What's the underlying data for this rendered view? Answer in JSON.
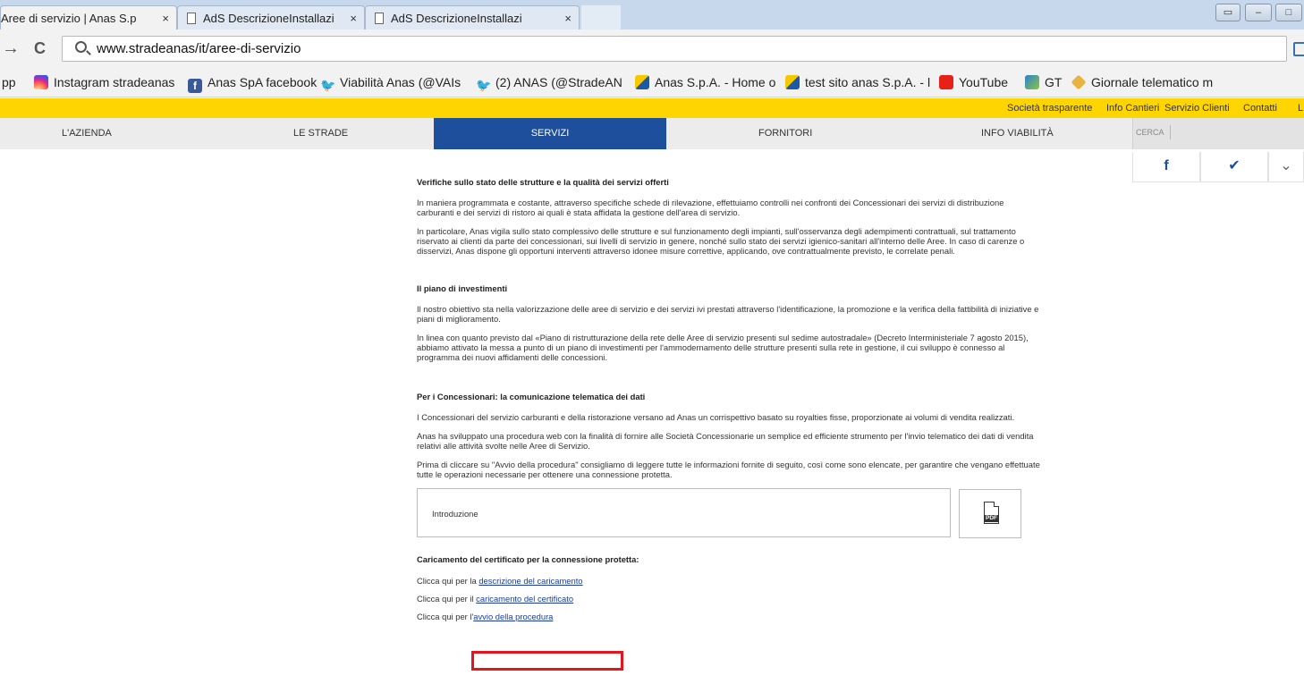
{
  "browser": {
    "tabs": [
      {
        "title": "Aree di servizio | Anas S.p",
        "close": "×"
      },
      {
        "title": "AdS DescrizioneInstallazi",
        "close": "×"
      },
      {
        "title": "AdS DescrizioneInstallazi",
        "close": "×"
      }
    ],
    "window_buttons": [
      "▭",
      "–",
      "□"
    ],
    "url": "www.stradeanas/it/aree-di-servizio",
    "nav": {
      "back": "→",
      "reload": "C"
    },
    "bookmarks_prefix": "pp",
    "bookmarks": [
      {
        "label": "Instagram stradeanas",
        "icon": "instagram-icon"
      },
      {
        "label": "Anas SpA facebook",
        "icon": "facebook-icon"
      },
      {
        "label": "Viabilità Anas (@VAIs",
        "icon": "twitter-icon"
      },
      {
        "label": "(2) ANAS (@StradeAN",
        "icon": "twitter-icon"
      },
      {
        "label": "Anas S.p.A. - Home o",
        "icon": "anas-icon"
      },
      {
        "label": "test sito anas S.p.A. - l",
        "icon": "anas-icon"
      },
      {
        "label": "YouTube",
        "icon": "youtube-icon"
      },
      {
        "label": "GT",
        "icon": "gt-icon"
      },
      {
        "label": "Giornale telematico m",
        "icon": "diamond-icon"
      }
    ]
  },
  "site": {
    "top_links": [
      "Società trasparente",
      "Info Cantieri",
      "Servizio Clienti",
      "Contatti",
      "L"
    ],
    "nav": [
      "L'AZIENDA",
      "LE STRADE",
      "SERVIZI",
      "FORNITORI",
      "INFO VIABILITÀ"
    ],
    "search_label": "CERCA",
    "social": [
      "f",
      "✔",
      "⌄"
    ]
  },
  "content": {
    "sec1_title": "Verifiche sullo stato delle strutture e la qualità dei servizi offerti",
    "sec1_p1": "In maniera programmata e costante, attraverso specifiche schede di rilevazione, effettuiamo controlli nei confronti dei Concessionari dei servizi di distribuzione carburanti e dei servizi di ristoro ai quali è stata affidata la gestione dell'area di servizio.",
    "sec1_p2": "In particolare, Anas vigila sullo stato complessivo delle strutture e sul funzionamento degli impianti, sull'osservanza degli adempimenti contrattuali, sul trattamento riservato ai clienti da parte dei concessionari, sui livelli di servizio in genere, nonché sullo stato dei servizi igienico-sanitari all'interno delle Aree. In caso di carenze o disservizi, Anas dispone gli opportuni interventi attraverso idonee misure correttive, applicando, ove contrattualmente previsto, le correlate penali.",
    "sec2_title": "Il piano di investimenti",
    "sec2_p1": "Il nostro obiettivo sta nella valorizzazione delle aree di servizio e dei servizi ivi prestati attraverso l'identificazione, la promozione e la verifica della fattibilità di iniziative e piani di miglioramento.",
    "sec2_p2": "In linea con quanto previsto dal «Piano di ristrutturazione della rete delle Aree di servizio presenti sul sedime autostradale» (Decreto Interministeriale 7 agosto 2015), abbiamo attivato la messa a punto di un piano di investimenti per l'ammodernamento delle strutture presenti sulla rete in gestione, il cui sviluppo è connesso al programma dei nuovi affidamenti delle concessioni.",
    "sec3_title": "Per i Concessionari: la comunicazione telematica dei dati",
    "sec3_p1": "I Concessionari del servizio carburanti e della ristorazione versano ad Anas un corrispettivo basato su royalties fisse, proporzionate ai volumi di vendita realizzati.",
    "sec3_p2": "Anas ha sviluppato una procedura web con la finalità di fornire alle Società Concessionarie un semplice ed efficiente strumento per l'invio telematico dei dati di vendita relativi alle attività svolte nelle Aree di Servizio.",
    "sec3_p3": "Prima di cliccare su \"Avvio della procedura\" consigliamo di leggere tutte le informazioni fornite di seguito, così come sono elencate, per garantire che vengano effettuate tutte le operazioni necessarie per ottenere una connessione protetta.",
    "intro_label": "Introduzione",
    "pdf_tag": "PDF",
    "cert_title": "Caricamento del certificato per la connessione protetta:",
    "links": [
      {
        "prefix": "Clicca qui per la ",
        "link": "descrizione del caricamento"
      },
      {
        "prefix": "Clicca qui per il ",
        "link": "caricamento del certificato"
      },
      {
        "prefix": "Clicca qui per l'",
        "link": "avvio della procedura"
      }
    ]
  },
  "colors": {
    "accent_yellow": "#ffd500",
    "nav_active": "#1d4f9c",
    "highlight": "#e3161e"
  }
}
